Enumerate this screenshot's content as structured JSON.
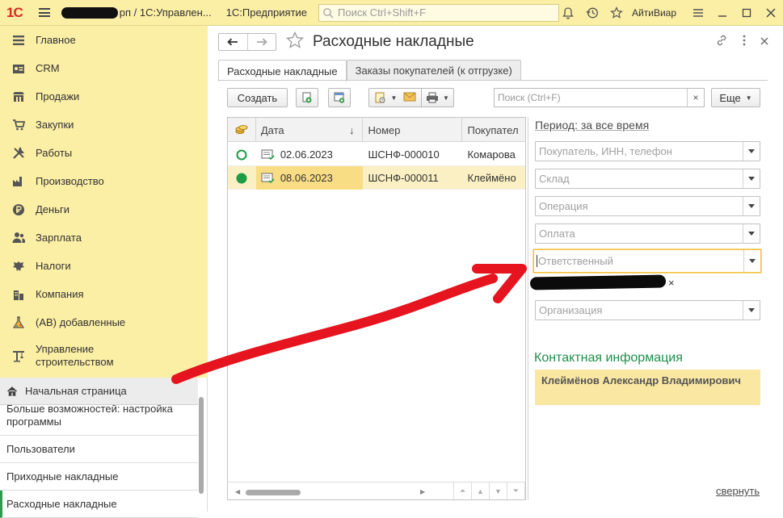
{
  "topbar": {
    "logo": "1С",
    "title_visible": "рп / 1С:Управлен...",
    "app_name": "1С:Предприятие",
    "search_placeholder": "Поиск Ctrl+Shift+F",
    "user": "АйтиВиар"
  },
  "sidebar": {
    "items": [
      {
        "label": "Главное",
        "icon": "menu-lines-icon"
      },
      {
        "label": "CRM",
        "icon": "crm-card-icon"
      },
      {
        "label": "Продажи",
        "icon": "shop-icon"
      },
      {
        "label": "Закупки",
        "icon": "cart-icon"
      },
      {
        "label": "Работы",
        "icon": "tools-icon"
      },
      {
        "label": "Производство",
        "icon": "factory-icon"
      },
      {
        "label": "Деньги",
        "icon": "ruble-coin-icon"
      },
      {
        "label": "Зарплата",
        "icon": "people-icon"
      },
      {
        "label": "Налоги",
        "icon": "eagle-emblem-icon"
      },
      {
        "label": "Компания",
        "icon": "buildings-icon"
      },
      {
        "label": "(АВ) добавленные",
        "icon": "flask-icon"
      },
      {
        "label": "Управление строительством",
        "icon": "crane-icon"
      }
    ]
  },
  "open_windows": {
    "home": "Начальная страница",
    "items": [
      "Больше возможностей: настройка программы",
      "Пользователи",
      "Приходные накладные",
      "Расходные накладные"
    ]
  },
  "form": {
    "title": "Расходные накладные",
    "tabs": [
      "Расходные накладные",
      "Заказы покупателей (к отгрузке)"
    ],
    "toolbar": {
      "create": "Создать",
      "search_placeholder": "Поиск (Ctrl+F)",
      "clear": "×",
      "more": "Еще"
    },
    "table": {
      "columns": [
        "Дата",
        "Номер",
        "Покупател"
      ],
      "sort_indicator": "↓",
      "rows": [
        {
          "date": "02.06.2023",
          "number": "ШСНФ-000010",
          "customer": "Комарова",
          "status": "not-posted"
        },
        {
          "date": "08.06.2023",
          "number": "ШСНФ-000011",
          "customer": "Клеймёно",
          "status": "posted"
        }
      ]
    },
    "filters": {
      "period": "Период: за все время",
      "customer_placeholder": "Покупатель, ИНН, телефон",
      "warehouse_placeholder": "Склад",
      "operation_placeholder": "Операция",
      "payment_placeholder": "Оплата",
      "responsible_placeholder": "Ответственный",
      "responsible_clear": "×",
      "organization_placeholder": "Организация"
    },
    "contact": {
      "title": "Контактная информация",
      "name": "Клеймёнов Александр Владимирович"
    },
    "collapse_link": "свернуть"
  },
  "colors": {
    "accent_yellow": "#fbeea5",
    "selected_row": "#fbf0c3",
    "contact_green": "#1e8f4a",
    "annotation_red": "#e5141e"
  }
}
